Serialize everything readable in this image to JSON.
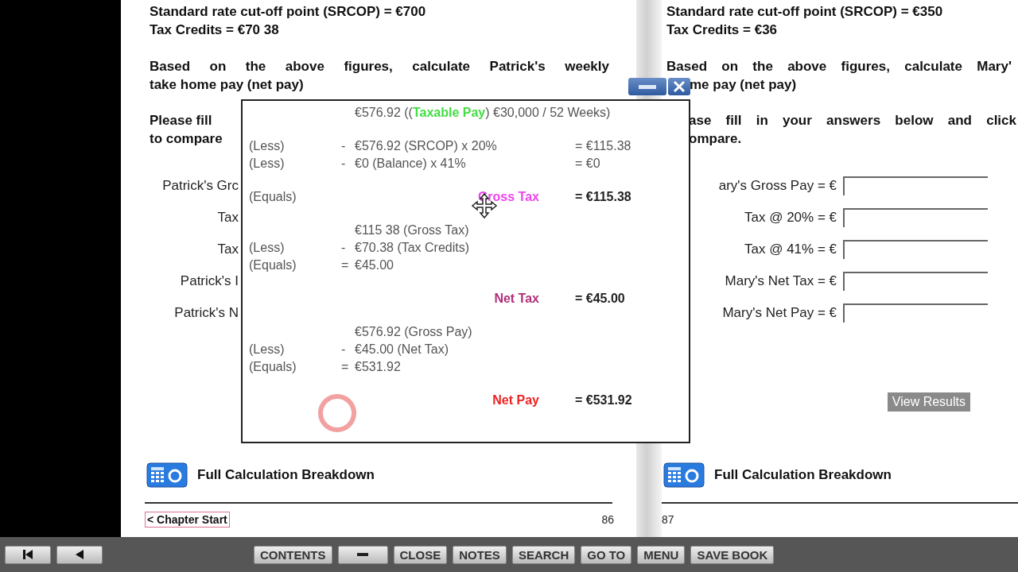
{
  "left_page": {
    "facts": [
      "Standard rate cut-off point (SRCOP) = €700",
      "Tax Credits = €70 38"
    ],
    "question": [
      "Based on the above figures, calculate Patrick's weekly",
      "take home pay (net pay)"
    ],
    "instruction": [
      "Please fill",
      "to compare"
    ],
    "fields": [
      {
        "label": "Patrick's Grc"
      },
      {
        "label": "Tax"
      },
      {
        "label": "Tax"
      },
      {
        "label": "Patrick's I"
      },
      {
        "label": "Patrick's N"
      }
    ],
    "calc_link": "Full Calculation Breakdown",
    "chapter_link": "< Chapter Start",
    "page_number": "86"
  },
  "popup": {
    "sections": [
      [
        {
          "kind": "header",
          "prefix": "€576.92 ((",
          "highlight": "Taxable Pay",
          "color": "#44dd44",
          "suffix": ") €30,000 / 52 Weeks)"
        }
      ],
      [
        {
          "kind": "line",
          "label": "(Less)",
          "op": "-",
          "text": "€576.92 (SRCOP) x 20%",
          "result": "= €115.38"
        },
        {
          "kind": "line",
          "label": "(Less)",
          "op": "-",
          "text": "€0 (Balance) x 41%",
          "result": "= €0"
        }
      ],
      [
        {
          "kind": "total",
          "label": "(Equals)",
          "title": "Gross Tax",
          "color": "#ee44ee",
          "result": "= €115.38"
        }
      ],
      [
        {
          "kind": "line",
          "text": "€115 38 (Gross Tax)"
        },
        {
          "kind": "line",
          "label": "(Less)",
          "op": "-",
          "text": "€70.38 (Tax Credits)"
        },
        {
          "kind": "line",
          "label": "(Equals)",
          "op": "=",
          "text": "€45.00"
        }
      ],
      [
        {
          "kind": "total",
          "title": "Net Tax",
          "color": "#b0307a",
          "result": "= €45.00"
        }
      ],
      [
        {
          "kind": "line",
          "text": "€576.92 (Gross Pay)"
        },
        {
          "kind": "line",
          "label": "(Less)",
          "op": "-",
          "text": "€45.00 (Net Tax)"
        },
        {
          "kind": "line",
          "label": "(Equals)",
          "op": "=",
          "text": "€531.92"
        }
      ],
      [
        {
          "kind": "total",
          "title": "Net Pay",
          "color": "#ee2222",
          "result": "= €531.92"
        }
      ]
    ]
  },
  "right_page": {
    "facts": [
      "Standard rate cut-off point (SRCOP) = €350",
      "Tax Credits = €36"
    ],
    "question": [
      "Based on the above figures, calculate Mary'",
      "me pay (net pay)"
    ],
    "instruction": [
      "ase fill in your answers below and click",
      "ompare."
    ],
    "fields": [
      {
        "label": "ary's Gross Pay = €"
      },
      {
        "label": "Tax @ 20% = €"
      },
      {
        "label": "Tax @ 41% = €"
      },
      {
        "label": "Mary's Net Tax = €"
      },
      {
        "label": "Mary's Net Pay = €"
      }
    ],
    "view_button": "View Results",
    "calc_link": "Full Calculation Breakdown",
    "page_number": "87"
  },
  "toolbar": {
    "nav": [
      {
        "kind": "first"
      },
      {
        "kind": "previous"
      }
    ],
    "buttons": [
      {
        "kind": "text",
        "label": "CONTENTS"
      },
      {
        "kind": "minimize"
      },
      {
        "kind": "text",
        "label": "CLOSE"
      },
      {
        "kind": "text",
        "label": "NOTES"
      },
      {
        "kind": "text",
        "label": "SEARCH"
      },
      {
        "kind": "text",
        "label": "GO TO"
      },
      {
        "kind": "text",
        "label": "MENU"
      },
      {
        "kind": "text",
        "label": "SAVE BOOK"
      }
    ]
  }
}
